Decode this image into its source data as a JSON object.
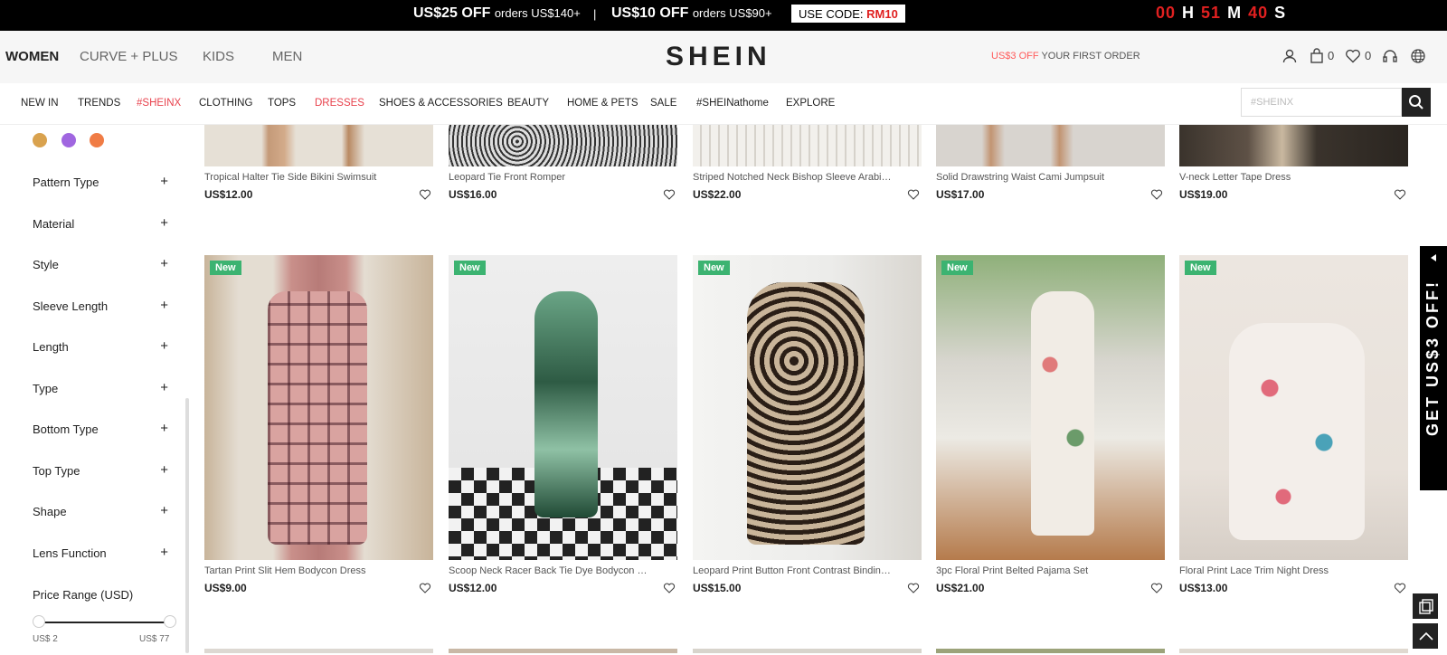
{
  "promo": {
    "offer1_bold": "US$25 OFF",
    "offer1_small": "orders US$140+",
    "separator": "|",
    "offer2_bold": "US$10 OFF",
    "offer2_small": "orders US$90+",
    "code_label": "USE CODE:",
    "code_value": "RM10",
    "timer": {
      "hours": "00",
      "h": "H",
      "minutes": "51",
      "m": "M",
      "seconds": "40",
      "s": "S"
    }
  },
  "header": {
    "categories": [
      "WOMEN",
      "CURVE + PLUS",
      "KIDS",
      "MEN"
    ],
    "logo": "SHEIN",
    "offer_red": "US$3 OFF",
    "offer_text": "YOUR FIRST ORDER",
    "bag_count": "0",
    "wishlist_count": "0"
  },
  "nav": {
    "items": [
      "NEW IN",
      "TRENDS",
      "#SHEINX",
      "CLOTHING",
      "TOPS",
      "DRESSES",
      "SHOES & ACCESSORIES",
      "BEAUTY",
      "HOME & PETS",
      "SALE",
      "#SHEINathome",
      "EXPLORE"
    ],
    "search_placeholder": "#SHEINX"
  },
  "sidebar": {
    "color_dots": [
      "#d9a24e",
      "#a066e0",
      "#f07c45"
    ],
    "filters": [
      "Pattern Type",
      "Material",
      "Style",
      "Sleeve Length",
      "Length",
      "Type",
      "Bottom Type",
      "Top Type",
      "Shape",
      "Lens Function"
    ],
    "price_title": "Price Range (USD)",
    "price_min": "US$ 2",
    "price_max": "US$ 77"
  },
  "products_row1": [
    {
      "title": "Tropical Halter Tie Side Bikini Swimsuit",
      "price": "US$12.00"
    },
    {
      "title": "Leopard Tie Front Romper",
      "price": "US$16.00"
    },
    {
      "title": "Striped Notched Neck Bishop Sleeve Arabian Dress",
      "price": "US$22.00"
    },
    {
      "title": "Solid Drawstring Waist Cami Jumpsuit",
      "price": "US$17.00"
    },
    {
      "title": "V-neck Letter Tape Dress",
      "price": "US$19.00"
    }
  ],
  "products_row2": [
    {
      "badge": "New",
      "title": "Tartan Print Slit Hem Bodycon Dress",
      "price": "US$9.00"
    },
    {
      "badge": "New",
      "title": "Scoop Neck Racer Back Tie Dye Bodycon Dress",
      "price": "US$12.00"
    },
    {
      "badge": "New",
      "title": "Leopard Print Button Front Contrast Binding Satin Ni...",
      "price": "US$15.00"
    },
    {
      "badge": "New",
      "title": "3pc Floral Print Belted Pajama Set",
      "price": "US$21.00"
    },
    {
      "badge": "New",
      "title": "Floral Print Lace Trim Night Dress",
      "price": "US$13.00"
    }
  ],
  "side_banner": "GET US$3 OFF!"
}
